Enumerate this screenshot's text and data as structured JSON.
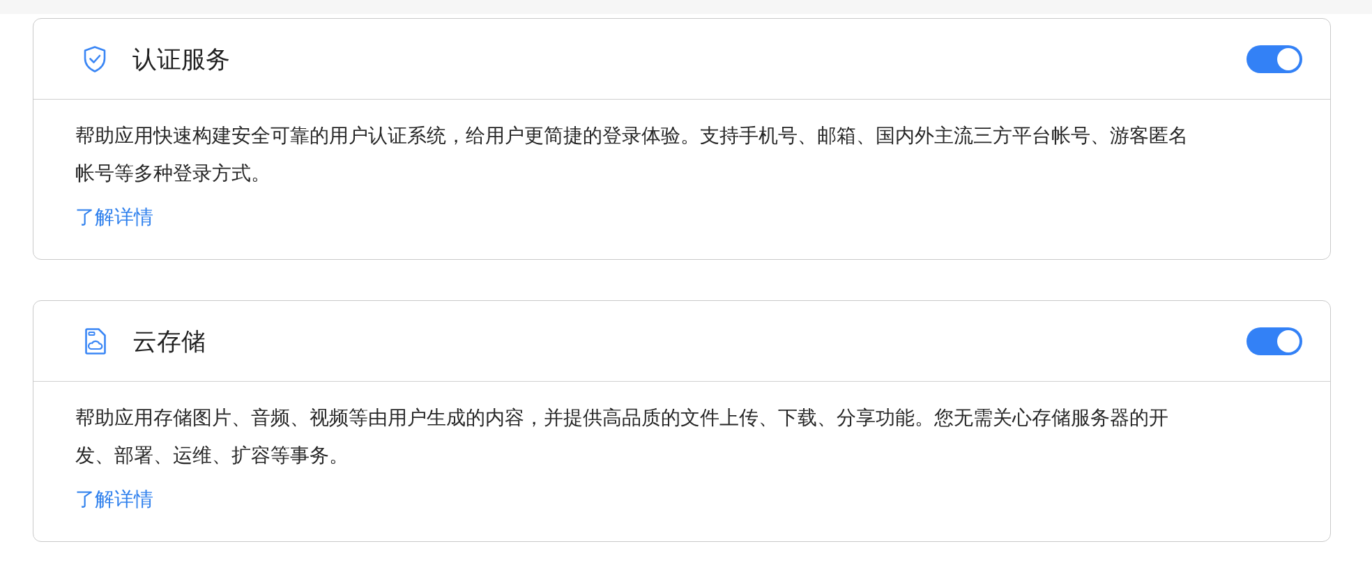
{
  "services": [
    {
      "kind": "auth",
      "title": "认证服务",
      "on": true,
      "description": "帮助应用快速构建安全可靠的用户认证系统，给用户更简捷的登录体验。支持手机号、邮箱、国内外主流三方平台帐号、游客匿名帐号等多种登录方式。",
      "link": "了解详情"
    },
    {
      "kind": "storage",
      "title": "云存储",
      "on": true,
      "description": "帮助应用存储图片、音频、视频等由用户生成的内容，并提供高品质的文件上传、下载、分享功能。您无需关心存储服务器的开发、部署、运维、扩容等事务。",
      "link": "了解详情"
    }
  ]
}
